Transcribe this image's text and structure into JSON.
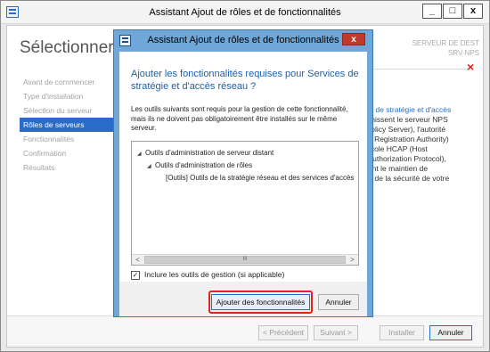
{
  "window": {
    "title": "Assistant Ajout de rôles et de fonctionnalités",
    "minimize_glyph": "_",
    "maximize_glyph": "□",
    "close_glyph": "x"
  },
  "background": {
    "page_title": "Sélectionner de",
    "destination_lines": [
      "SERVEUR DE DEST",
      "SRV-NPS"
    ],
    "close_glyph": "×",
    "steps": [
      {
        "label": "Avant de commencer",
        "active": false
      },
      {
        "label": "Type d'installation",
        "active": false
      },
      {
        "label": "Sélection du serveur",
        "active": false
      },
      {
        "label": "Rôles de serveurs",
        "active": true
      },
      {
        "label": "Fonctionnalités",
        "active": false
      },
      {
        "label": "Confirmation",
        "active": false
      },
      {
        "label": "Résultats",
        "active": false
      }
    ],
    "description": {
      "title": "ion",
      "lines": [
        {
          "text": "ices de stratégie et d'accès",
          "link": true
        },
        {
          "text": "ournissent le serveur NPS",
          "link": false
        },
        {
          "text": "k Policy Server), l'autorité",
          "link": false
        },
        {
          "text": "alth Registration Authority)",
          "link": false
        },
        {
          "text": "otocole HCAP (Host",
          "link": false
        },
        {
          "text": "al Authorization Protocol),",
          "link": false
        },
        {
          "text": "risent le maintien de",
          "link": false
        },
        {
          "text": "é et de la sécurité de votre",
          "link": false
        }
      ]
    },
    "footer": {
      "previous": "< Précédent",
      "next": "Suivant >",
      "install": "Installer",
      "cancel": "Annuler"
    }
  },
  "dialog": {
    "title": "Assistant Ajout de rôles et de fonctionnalités",
    "close_glyph": "x",
    "heading": "Ajouter les fonctionnalités requises pour Services de stratégie et d'accès réseau ?",
    "description": "Les outils suivants sont requis pour la gestion de cette fonctionnalité, mais ils ne doivent pas obligatoirement être installés sur le même serveur.",
    "tree": [
      {
        "label": "Outils d'administration de serveur distant",
        "level": 0,
        "toggle": "◢"
      },
      {
        "label": "Outils d'administration de rôles",
        "level": 1,
        "toggle": "◢"
      },
      {
        "label": "[Outils] Outils de la stratégie réseau et des services d'accès",
        "level": 2,
        "toggle": ""
      }
    ],
    "scroll_left": "<",
    "scroll_right": ">",
    "scroll_grip": "III",
    "checkbox": {
      "label": "Inclure les outils de gestion (si applicable)",
      "checked": true,
      "check_glyph": "✓"
    },
    "add_button": "Ajouter des fonctionnalités",
    "cancel_button": "Annuler"
  },
  "colors": {
    "accent": "#2a6cc8",
    "dialog_frame": "#6ea7d8",
    "close_red": "#c0392b",
    "highlight_red": "#e02222"
  }
}
